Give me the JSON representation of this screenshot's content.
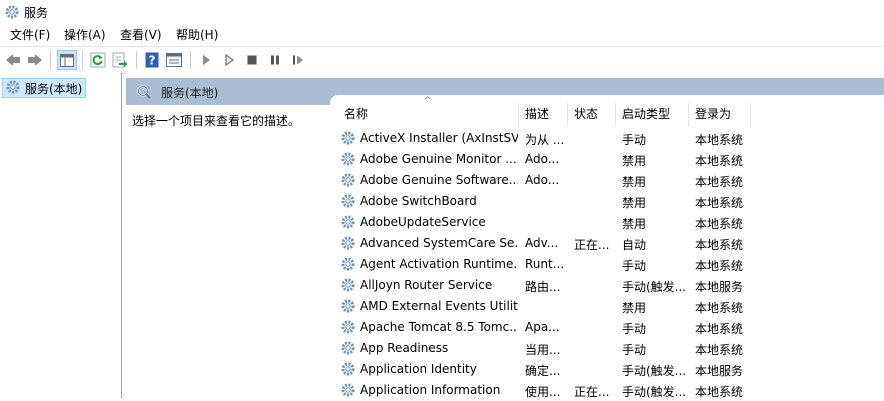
{
  "window": {
    "title": "服务"
  },
  "menu": [
    {
      "label": "文件(F)"
    },
    {
      "label": "操作(A)"
    },
    {
      "label": "查看(V)"
    },
    {
      "label": "帮助(H)"
    }
  ],
  "toolbar": {
    "icons": [
      "back-arrow-icon",
      "forward-arrow-icon",
      "show-hide-tree-icon",
      "refresh-icon",
      "export-list-icon",
      "help-icon",
      "properties-icon",
      "start-service-icon",
      "start-service-params-icon",
      "stop-service-icon",
      "pause-service-icon",
      "resume-service-icon"
    ]
  },
  "tree": {
    "root_label": "服务(本地)"
  },
  "right_header": {
    "title": "服务(本地)"
  },
  "description": {
    "prompt": "选择一个项目来查看它的描述。"
  },
  "columns": {
    "name": "名称",
    "description": "描述",
    "status": "状态",
    "startup_type": "启动类型",
    "logon_as": "登录为",
    "sort_indicator": "^"
  },
  "services": [
    {
      "name": "ActiveX Installer (AxInstSV)",
      "description": "为从 ...",
      "status": "",
      "startup": "手动",
      "logon": "本地系统"
    },
    {
      "name": "Adobe Genuine Monitor ...",
      "description": "Ado...",
      "status": "",
      "startup": "禁用",
      "logon": "本地系统"
    },
    {
      "name": "Adobe Genuine Software...",
      "description": "Ado...",
      "status": "",
      "startup": "禁用",
      "logon": "本地系统"
    },
    {
      "name": "Adobe SwitchBoard",
      "description": "",
      "status": "",
      "startup": "禁用",
      "logon": "本地系统"
    },
    {
      "name": "AdobeUpdateService",
      "description": "",
      "status": "",
      "startup": "禁用",
      "logon": "本地系统"
    },
    {
      "name": "Advanced SystemCare Se...",
      "description": "Adv...",
      "status": "正在...",
      "startup": "自动",
      "logon": "本地系统"
    },
    {
      "name": "Agent Activation Runtime...",
      "description": "Runt...",
      "status": "",
      "startup": "手动",
      "logon": "本地系统"
    },
    {
      "name": "AllJoyn Router Service",
      "description": "路由...",
      "status": "",
      "startup": "手动(触发...",
      "logon": "本地服务"
    },
    {
      "name": "AMD External Events Utility",
      "description": "",
      "status": "",
      "startup": "禁用",
      "logon": "本地系统"
    },
    {
      "name": "Apache Tomcat 8.5 Tomc...",
      "description": "Apa...",
      "status": "",
      "startup": "手动",
      "logon": "本地系统"
    },
    {
      "name": "App Readiness",
      "description": "当用...",
      "status": "",
      "startup": "手动",
      "logon": "本地系统"
    },
    {
      "name": "Application Identity",
      "description": "确定...",
      "status": "",
      "startup": "手动(触发...",
      "logon": "本地服务"
    },
    {
      "name": "Application Information",
      "description": "使用...",
      "status": "正在...",
      "startup": "手动(触发...",
      "logon": "本地系统"
    }
  ]
}
